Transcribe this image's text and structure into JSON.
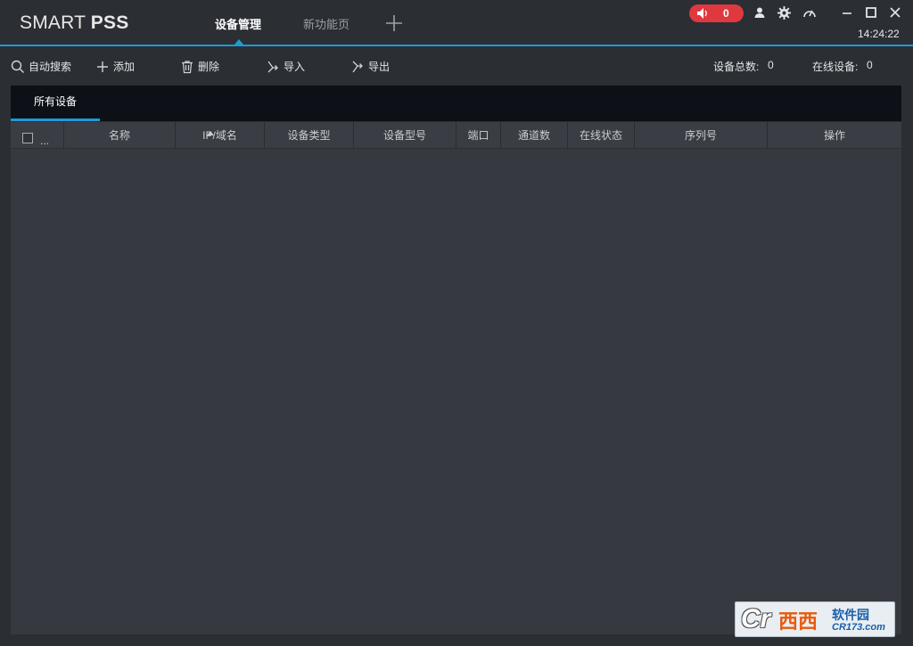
{
  "app": {
    "logo_light": "SMART ",
    "logo_bold": "PSS"
  },
  "tabs": [
    {
      "label": "设备管理",
      "active": true
    },
    {
      "label": "新功能页",
      "active": false
    }
  ],
  "alarm": {
    "count": "0",
    "color": "#e0383f"
  },
  "clock": "14:24:22",
  "toolbar": {
    "auto_search": "自动搜索",
    "add": "添加",
    "delete": "删除",
    "import": "导入",
    "export": "导出"
  },
  "stats": {
    "total_label": "设备总数:",
    "total_value": "0",
    "online_label": "在线设备:",
    "online_value": "0"
  },
  "device_tab": "所有设备",
  "table": {
    "select_more": "...",
    "columns": [
      "名称",
      "IP/域名",
      "设备类型",
      "设备型号",
      "端口",
      "通道数",
      "在线状态",
      "序列号",
      "操作"
    ],
    "rows": []
  },
  "watermark": {
    "mark": "Cr",
    "brand": "西西",
    "name": "软件园",
    "url": "CR173.com"
  },
  "colors": {
    "accent": "#1d9bd9",
    "background": "#2b2e33",
    "table_bg": "#363a40"
  }
}
